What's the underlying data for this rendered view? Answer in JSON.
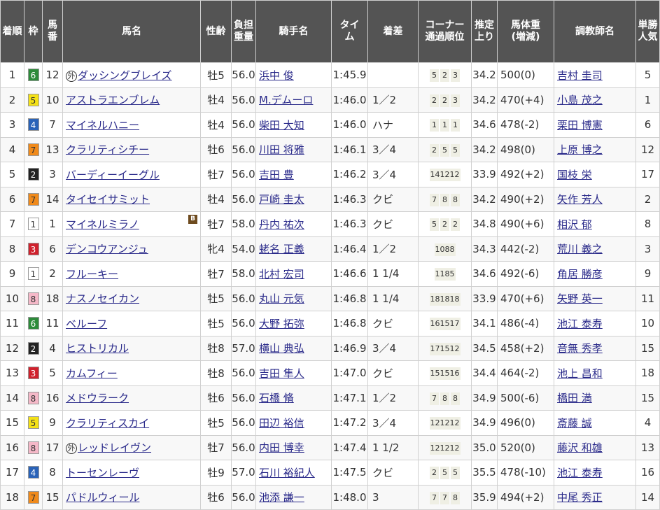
{
  "columns": [
    "着順",
    "枠",
    "馬番",
    "馬名",
    "性齢",
    "負担重量",
    "騎手名",
    "タイム",
    "着差",
    "コーナー通過順位",
    "推定上り",
    "馬体重(増減)",
    "調教師名",
    "単勝人気"
  ],
  "frame_colors": {
    "1": {
      "bg": "#ffffff",
      "fg": "#333333"
    },
    "2": {
      "bg": "#222222",
      "fg": "#ffffff"
    },
    "3": {
      "bg": "#d0212d",
      "fg": "#ffffff"
    },
    "4": {
      "bg": "#2a63b8",
      "fg": "#ffffff"
    },
    "5": {
      "bg": "#f4e116",
      "fg": "#333333"
    },
    "6": {
      "bg": "#2d8b3a",
      "fg": "#ffffff"
    },
    "7": {
      "bg": "#f08a1b",
      "fg": "#333333"
    },
    "8": {
      "bg": "#f5b8c8",
      "fg": "#333333"
    }
  },
  "rows": [
    {
      "rank": "1",
      "frame": "6",
      "num": "12",
      "mark": "外",
      "horse": "ダッシングブレイズ",
      "blinker": "",
      "sexage": "牡5",
      "weight": "56.0",
      "jockey": "浜中 俊",
      "time": "1:45.9",
      "margin": "",
      "corner": [
        "5",
        "2",
        "3"
      ],
      "last3f": "34.2",
      "body": "500(0)",
      "trainer": "吉村 圭司",
      "pop": "5"
    },
    {
      "rank": "2",
      "frame": "5",
      "num": "10",
      "mark": "",
      "horse": "アストラエンブレム",
      "blinker": "",
      "sexage": "牡4",
      "weight": "56.0",
      "jockey": "M.デムーロ",
      "time": "1:46.0",
      "margin": "1／2",
      "corner": [
        "2",
        "2",
        "3"
      ],
      "last3f": "34.2",
      "body": "470(+4)",
      "trainer": "小島 茂之",
      "pop": "1"
    },
    {
      "rank": "3",
      "frame": "4",
      "num": "7",
      "mark": "",
      "horse": "マイネルハニー",
      "blinker": "",
      "sexage": "牡4",
      "weight": "56.0",
      "jockey": "柴田 大知",
      "time": "1:46.0",
      "margin": "ハナ",
      "corner": [
        "1",
        "1",
        "1"
      ],
      "last3f": "34.6",
      "body": "478(-2)",
      "trainer": "栗田 博憲",
      "pop": "6"
    },
    {
      "rank": "4",
      "frame": "7",
      "num": "13",
      "mark": "",
      "horse": "クラリティシチー",
      "blinker": "",
      "sexage": "牡6",
      "weight": "56.0",
      "jockey": "川田 将雅",
      "time": "1:46.1",
      "margin": "3／4",
      "corner": [
        "2",
        "5",
        "5"
      ],
      "last3f": "34.2",
      "body": "498(0)",
      "trainer": "上原 博之",
      "pop": "12"
    },
    {
      "rank": "5",
      "frame": "2",
      "num": "3",
      "mark": "",
      "horse": "バーディーイーグル",
      "blinker": "",
      "sexage": "牡7",
      "weight": "56.0",
      "jockey": "吉田 豊",
      "time": "1:46.2",
      "margin": "3／4",
      "corner": [
        "14",
        "12",
        "12"
      ],
      "last3f": "33.9",
      "body": "492(+2)",
      "trainer": "国枝 栄",
      "pop": "17"
    },
    {
      "rank": "6",
      "frame": "7",
      "num": "14",
      "mark": "",
      "horse": "タイセイサミット",
      "blinker": "",
      "sexage": "牡4",
      "weight": "56.0",
      "jockey": "戸崎 圭太",
      "time": "1:46.3",
      "margin": "クビ",
      "corner": [
        "7",
        "8",
        "8"
      ],
      "last3f": "34.2",
      "body": "490(+2)",
      "trainer": "矢作 芳人",
      "pop": "2"
    },
    {
      "rank": "7",
      "frame": "1",
      "num": "1",
      "mark": "",
      "horse": "マイネルミラノ",
      "blinker": "B",
      "sexage": "牡7",
      "weight": "58.0",
      "jockey": "丹内 祐次",
      "time": "1:46.3",
      "margin": "クビ",
      "corner": [
        "5",
        "2",
        "2"
      ],
      "last3f": "34.8",
      "body": "490(+6)",
      "trainer": "相沢 郁",
      "pop": "8"
    },
    {
      "rank": "8",
      "frame": "3",
      "num": "6",
      "mark": "",
      "horse": "デンコウアンジュ",
      "blinker": "",
      "sexage": "牝4",
      "weight": "54.0",
      "jockey": "蛯名 正義",
      "time": "1:46.4",
      "margin": "1／2",
      "corner": [
        "10",
        "8",
        "8"
      ],
      "last3f": "34.3",
      "body": "442(-2)",
      "trainer": "荒川 義之",
      "pop": "3"
    },
    {
      "rank": "9",
      "frame": "1",
      "num": "2",
      "mark": "",
      "horse": "フルーキー",
      "blinker": "",
      "sexage": "牡7",
      "weight": "58.0",
      "jockey": "北村 宏司",
      "time": "1:46.6",
      "margin": "1 1/4",
      "corner": [
        "11",
        "8",
        "5"
      ],
      "last3f": "34.6",
      "body": "492(-6)",
      "trainer": "角居 勝彦",
      "pop": "9"
    },
    {
      "rank": "10",
      "frame": "8",
      "num": "18",
      "mark": "",
      "horse": "ナスノセイカン",
      "blinker": "",
      "sexage": "牡5",
      "weight": "56.0",
      "jockey": "丸山 元気",
      "time": "1:46.8",
      "margin": "1 1/4",
      "corner": [
        "18",
        "18",
        "18"
      ],
      "last3f": "33.9",
      "body": "470(+6)",
      "trainer": "矢野 英一",
      "pop": "11"
    },
    {
      "rank": "11",
      "frame": "6",
      "num": "11",
      "mark": "",
      "horse": "ベルーフ",
      "blinker": "",
      "sexage": "牡5",
      "weight": "56.0",
      "jockey": "大野 拓弥",
      "time": "1:46.8",
      "margin": "クビ",
      "corner": [
        "16",
        "15",
        "17"
      ],
      "last3f": "34.1",
      "body": "486(-4)",
      "trainer": "池江 泰寿",
      "pop": "10"
    },
    {
      "rank": "12",
      "frame": "2",
      "num": "4",
      "mark": "",
      "horse": "ヒストリカル",
      "blinker": "",
      "sexage": "牡8",
      "weight": "57.0",
      "jockey": "横山 典弘",
      "time": "1:46.9",
      "margin": "3／4",
      "corner": [
        "17",
        "15",
        "12"
      ],
      "last3f": "34.5",
      "body": "458(+2)",
      "trainer": "音無 秀孝",
      "pop": "15"
    },
    {
      "rank": "13",
      "frame": "3",
      "num": "5",
      "mark": "",
      "horse": "カムフィー",
      "blinker": "",
      "sexage": "牡8",
      "weight": "56.0",
      "jockey": "吉田 隼人",
      "time": "1:47.0",
      "margin": "クビ",
      "corner": [
        "15",
        "15",
        "16"
      ],
      "last3f": "34.4",
      "body": "464(-2)",
      "trainer": "池上 昌和",
      "pop": "18"
    },
    {
      "rank": "14",
      "frame": "8",
      "num": "16",
      "mark": "",
      "horse": "メドウラーク",
      "blinker": "",
      "sexage": "牡6",
      "weight": "56.0",
      "jockey": "石橋 脩",
      "time": "1:47.1",
      "margin": "1／2",
      "corner": [
        "7",
        "8",
        "8"
      ],
      "last3f": "34.9",
      "body": "500(-6)",
      "trainer": "橋田 満",
      "pop": "15"
    },
    {
      "rank": "15",
      "frame": "5",
      "num": "9",
      "mark": "",
      "horse": "クラリティスカイ",
      "blinker": "",
      "sexage": "牡5",
      "weight": "56.0",
      "jockey": "田辺 裕信",
      "time": "1:47.2",
      "margin": "3／4",
      "corner": [
        "12",
        "12",
        "12"
      ],
      "last3f": "34.9",
      "body": "496(0)",
      "trainer": "斎藤 誠",
      "pop": "4"
    },
    {
      "rank": "16",
      "frame": "8",
      "num": "17",
      "mark": "外",
      "horse": "レッドレイヴン",
      "blinker": "",
      "sexage": "牡7",
      "weight": "56.0",
      "jockey": "内田 博幸",
      "time": "1:47.4",
      "margin": "1 1/2",
      "corner": [
        "12",
        "12",
        "12"
      ],
      "last3f": "35.0",
      "body": "520(0)",
      "trainer": "藤沢 和雄",
      "pop": "13"
    },
    {
      "rank": "17",
      "frame": "4",
      "num": "8",
      "mark": "",
      "horse": "トーセンレーヴ",
      "blinker": "",
      "sexage": "牡9",
      "weight": "57.0",
      "jockey": "石川 裕紀人",
      "time": "1:47.5",
      "margin": "クビ",
      "corner": [
        "2",
        "5",
        "5"
      ],
      "last3f": "35.5",
      "body": "478(-10)",
      "trainer": "池江 泰寿",
      "pop": "16"
    },
    {
      "rank": "18",
      "frame": "7",
      "num": "15",
      "mark": "",
      "horse": "パドルウィール",
      "blinker": "",
      "sexage": "牡6",
      "weight": "56.0",
      "jockey": "池添 謙一",
      "time": "1:48.0",
      "margin": "3",
      "corner": [
        "7",
        "7",
        "8"
      ],
      "last3f": "35.9",
      "body": "494(+2)",
      "trainer": "中尾 秀正",
      "pop": "14"
    }
  ]
}
